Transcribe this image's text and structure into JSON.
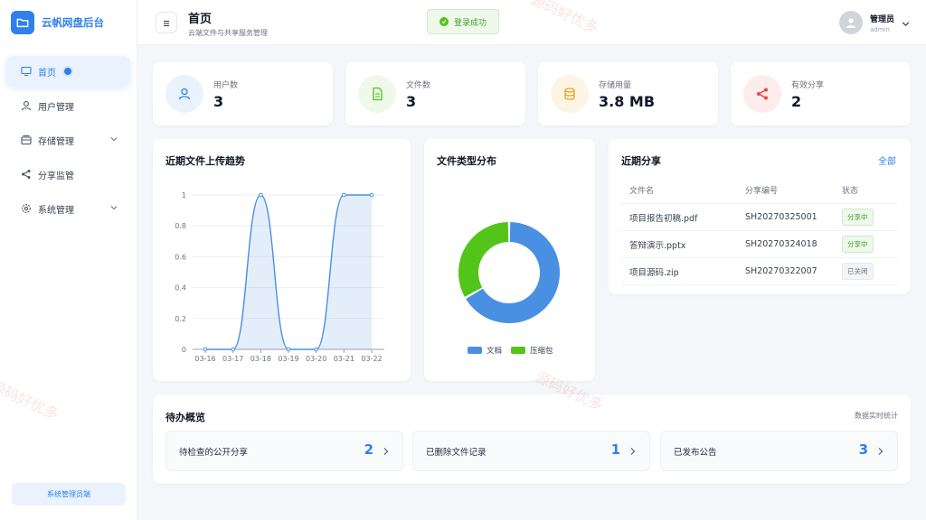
{
  "brand": {
    "name": "云帆网盘后台"
  },
  "sidebar": {
    "items": [
      {
        "label": "首页",
        "icon": "monitor-icon",
        "active": true
      },
      {
        "label": "用户管理",
        "icon": "user-icon"
      },
      {
        "label": "存储管理",
        "icon": "storage-icon",
        "has_children": true
      },
      {
        "label": "分享监管",
        "icon": "share-icon"
      },
      {
        "label": "系统管理",
        "icon": "gear-icon",
        "has_children": true
      }
    ],
    "footer": "系统管理员端"
  },
  "header": {
    "title": "首页",
    "subtitle": "云端文件与共享服务管理",
    "toast": "登录成功",
    "user_name": "管理员",
    "user_id": "admin"
  },
  "stats": [
    {
      "label": "用户数",
      "value": "3",
      "icon": "user-icon",
      "color": "#2f80ed",
      "bg": "#eaf2fd"
    },
    {
      "label": "文件数",
      "value": "3",
      "icon": "file-icon",
      "color": "#52c41a",
      "bg": "#eef9ea"
    },
    {
      "label": "存储用量",
      "value": "3.8 MB",
      "icon": "database-icon",
      "color": "#e0a526",
      "bg": "#fdf5e4"
    },
    {
      "label": "有效分享",
      "value": "2",
      "icon": "share-icon",
      "color": "#ef4444",
      "bg": "#fdecec"
    }
  ],
  "trend": {
    "title": "近期文件上传趋势"
  },
  "pie": {
    "title": "文件类型分布"
  },
  "shares": {
    "title": "近期分享",
    "link": "全部",
    "columns": [
      "文件名",
      "分享编号",
      "状态"
    ],
    "rows": [
      {
        "name": "项目报告初稿.pdf",
        "code": "SH20270325001",
        "status": "分享中",
        "tone": "green"
      },
      {
        "name": "答辩演示.pptx",
        "code": "SH20270324018",
        "status": "分享中",
        "tone": "green"
      },
      {
        "name": "项目源码.zip",
        "code": "SH20270322007",
        "status": "已关闭",
        "tone": "gray"
      }
    ]
  },
  "todo": {
    "title": "待办概览",
    "note": "数据实时统计",
    "items": [
      {
        "label": "待检查的公开分享",
        "count": "2"
      },
      {
        "label": "已删除文件记录",
        "count": "1"
      },
      {
        "label": "已发布公告",
        "count": "3"
      }
    ]
  },
  "watermarks": [
    "源码好优多",
    "源码好优多",
    "源码好优多"
  ],
  "chart_data": [
    {
      "type": "area",
      "title": "近期文件上传趋势",
      "categories": [
        "03-16",
        "03-17",
        "03-18",
        "03-19",
        "03-20",
        "03-21",
        "03-22"
      ],
      "values": [
        0,
        0,
        1,
        0,
        0,
        1,
        1
      ],
      "ylim": [
        0,
        1
      ],
      "yticks": [
        "0",
        "0.2",
        "0.4",
        "0.6",
        "0.8",
        "1"
      ],
      "color": "#4a90e2",
      "grid": true
    },
    {
      "type": "pie",
      "title": "文件类型分布",
      "legend_position": "bottom",
      "labels": [
        "文档",
        "压缩包"
      ],
      "values": [
        2,
        1
      ],
      "colors": [
        "#4a90e2",
        "#52c41a"
      ]
    }
  ]
}
